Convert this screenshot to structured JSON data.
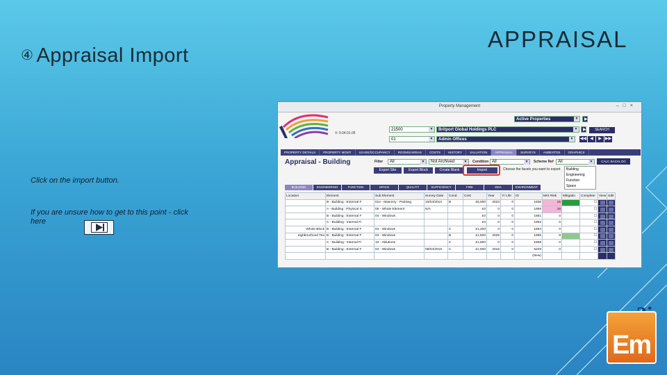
{
  "slide": {
    "title": "Appraisal Import",
    "bullet_icon": "circled-4-icon",
    "header": "APPRAISAL",
    "instruction": "Click on the import button.",
    "help_text": "If you are unsure how to get to this point - click here"
  },
  "window": {
    "title": "Property Management",
    "version": "V: 9.04.01.05",
    "property_code": "21500",
    "property_name": "Britport Global Holdings PLC",
    "location_code": "01",
    "location_name": "Admin Offices",
    "properties_filter": "Active Properties",
    "search_label": "SEARCH",
    "tabs": [
      "PROPERTY DETAILS",
      "PROPERTY MGMT",
      "LEASE/OCCUPANCY",
      "ROOMS/AREAS",
      "COSTS",
      "HISTORY",
      "VALUATION",
      "APPRAISAL",
      "SURVEYS",
      "ASBESTOS",
      "GRAPHICS"
    ],
    "active_tab": "APPRAISAL",
    "section_title": "Appraisal - Building",
    "filter_label": "Filter",
    "filter_value": "All",
    "archived_value": "Not Archived",
    "condition_label": "Condition",
    "condition_value": "All",
    "scheme_label": "Scheme Ref",
    "scheme_value": "All",
    "calc_label": "CALC BACKLOG",
    "actions": {
      "export_site": "Export Site",
      "export_block": "Export Block",
      "create_blank": "Create Blank",
      "import": "Import"
    },
    "facets_prompt": "Choose the facets you want to export",
    "facets": [
      "Building",
      "Engineering",
      "Function",
      "Space"
    ],
    "grid_tabs": [
      "BUILDING",
      "ENGINEERING",
      "FUNCTION",
      "SPACE",
      "QUALITY",
      "SUFFICIENCY",
      "FIRE",
      "DDA",
      "ENVIRONMENT"
    ],
    "columns": [
      "Location",
      "Element",
      "Sub Element",
      "Survey Date",
      "Cond.",
      "Cost",
      "Year",
      "Yr Life",
      "ID",
      "MIS Risk",
      "Mitigatio",
      "Complete",
      "View",
      "Edit"
    ],
    "rows": [
      {
        "location": "",
        "element": "B - Building : External F",
        "sub": "01e - Masonry - Paintwg",
        "date": "15/04/2013",
        "cond": "B",
        "cost": "£5,000",
        "year": "2023",
        "life": "0",
        "id": "1836",
        "risk": "15",
        "risk_color": "pink",
        "mit_color": "green"
      },
      {
        "location": "",
        "element": "A - Building : Physical S",
        "sub": "05 - Whole Element",
        "date": "N/A",
        "cond": "",
        "cost": "£0",
        "year": "0",
        "life": "0",
        "id": "1859",
        "risk": "16",
        "risk_color": "pink",
        "mit_color": ""
      },
      {
        "location": "",
        "element": "B - Building : External F",
        "sub": "04 - Windows",
        "date": "",
        "cond": "",
        "cost": "£0",
        "year": "0",
        "life": "0",
        "id": "1861",
        "risk": "0",
        "risk_color": "",
        "mit_color": ""
      },
      {
        "location": "",
        "element": "C - Building : Internal Fi",
        "sub": "",
        "date": "",
        "cond": "",
        "cost": "£0",
        "year": "0",
        "life": "0",
        "id": "1862",
        "risk": "0",
        "risk_color": "",
        "mit_color": ""
      },
      {
        "location": "Whole Block",
        "element": "B - Building : External F",
        "sub": "04 - Windows",
        "date": "",
        "cond": "C",
        "cost": "£1,200",
        "year": "0",
        "life": "0",
        "id": "1864",
        "risk": "0",
        "risk_color": "",
        "mit_color": ""
      },
      {
        "location": "eighbourhood Tea",
        "element": "B - Building : External F",
        "sub": "04 - Windows",
        "date": "",
        "cond": "B",
        "cost": "£1,500",
        "year": "2025",
        "life": "0",
        "id": "1865",
        "risk": "8",
        "risk_color": "",
        "mit_color": "lgreen"
      },
      {
        "location": "",
        "element": "C - Building : Internal Fi",
        "sub": "10 - Ablutions",
        "date": "",
        "cond": "C",
        "cost": "£1,500",
        "year": "0",
        "life": "0",
        "id": "1868",
        "risk": "0",
        "risk_color": "",
        "mit_color": ""
      },
      {
        "location": "",
        "element": "B - Building : External F",
        "sub": "04 - Windows",
        "date": "08/04/2015",
        "cond": "C",
        "cost": "£1,500",
        "year": "2015",
        "life": "0",
        "id": "5229",
        "risk": "0",
        "risk_color": "",
        "mit_color": ""
      },
      {
        "location": "",
        "element": "",
        "sub": "",
        "date": "",
        "cond": "",
        "cost": "",
        "year": "",
        "life": "",
        "id": "(New)",
        "risk": "",
        "risk_color": "",
        "mit_color": ""
      }
    ]
  },
  "logo": {
    "brand_3i": "3i",
    "brand_em": "Em"
  }
}
